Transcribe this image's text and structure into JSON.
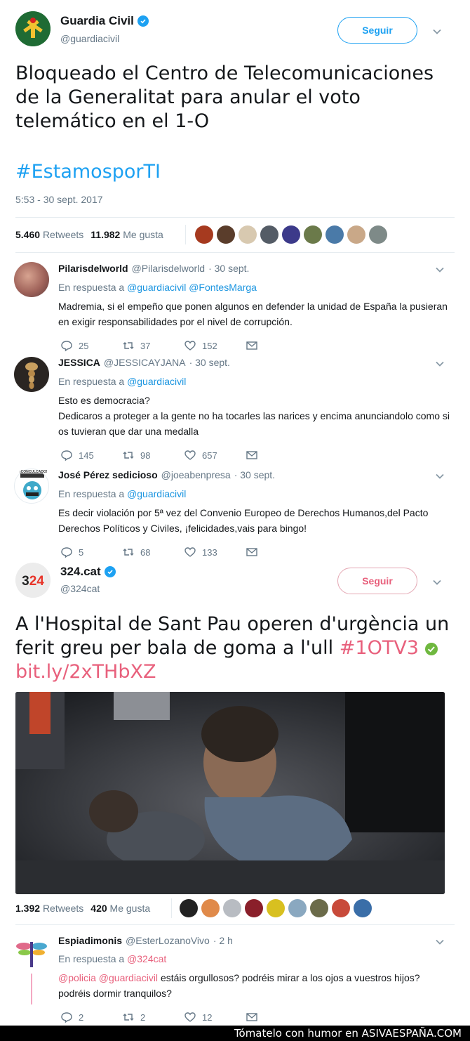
{
  "tweet1": {
    "name": "Guardia Civil",
    "handle": "@guardiacivil",
    "follow_label": "Seguir",
    "text": "Bloqueado el Centro de Telecomunicaciones de la Generalitat para anular el voto telemático en el 1-O",
    "hashtag": "#EstamosporTI",
    "timestamp": "5:53 - 30 sept. 2017",
    "retweets_count": "5.460",
    "retweets_label": "Retweets",
    "likes_count": "11.982",
    "likes_label": "Me gusta",
    "liker_colors": [
      "#a63a1f",
      "#5a3d2b",
      "#d8c9b0",
      "#545c66",
      "#3c3a8a",
      "#6b7a4a",
      "#4a7aa8",
      "#c9a888",
      "#7e8a88"
    ]
  },
  "replies": [
    {
      "name": "Pilarisdelworld",
      "handle": "@Pilarisdelworld",
      "date": "· 30 sept.",
      "in_reply_prefix": "En respuesta a",
      "mentions": [
        "@guardiacivil",
        "@FontesMarga"
      ],
      "text": "Madremia, si el empeño que ponen algunos en defender la unidad de España la pusieran en exigir responsabilidades por el nivel de corrupción.",
      "replies": "25",
      "retweets": "37",
      "likes": "152"
    },
    {
      "name": "JESSICA",
      "handle": "@JESSICAYJANA",
      "date": "· 30 sept.",
      "in_reply_prefix": "En respuesta a",
      "mentions": [
        "@guardiacivil"
      ],
      "text_line1": "Esto es democracia?",
      "text_line2": "Dedicaros a proteger a la gente no ha tocarles las narices y encima anunciandolo como si os tuvieran que dar una medalla",
      "replies": "145",
      "retweets": "98",
      "likes": "657"
    },
    {
      "name": "José Pérez sedicioso",
      "handle": "@joeabenpresa",
      "date": "· 30 sept.",
      "in_reply_prefix": "En respuesta a",
      "mentions": [
        "@guardiacivil"
      ],
      "text": "Es decir violación por 5ª vez del Convenio Europeo de Derechos Humanos,del Pacto Derechos Políticos y Civiles, ¡felicidades,vais para bingo!",
      "avatar_text": "¡CONCULCADO!",
      "replies": "5",
      "retweets": "68",
      "likes": "133"
    }
  ],
  "tweet2": {
    "name": "324.cat",
    "handle": "@324cat",
    "logo_text": "3 24",
    "follow_label": "Seguir",
    "text": "A l'Hospital de Sant Pau operen d'urgència un ferit greu per bala de goma a l'ull",
    "hashtag": "#1OTV3",
    "link": "bit.ly/2xTHbXZ",
    "retweets_count": "1.392",
    "retweets_label": "Retweets",
    "likes_count": "420",
    "likes_label": "Me gusta",
    "liker_colors": [
      "#222222",
      "#e08a4a",
      "#b8bcc2",
      "#8a1f2a",
      "#d8c020",
      "#8aa8c0",
      "#6b6b4a",
      "#c84a3a",
      "#3a6ea8"
    ]
  },
  "reply4": {
    "name": "Espiadimonis",
    "handle": "@EsterLozanoVivo",
    "date": "· 2 h",
    "in_reply_prefix": "En respuesta a",
    "mentions": [
      "@324cat"
    ],
    "mention_policia": "@policia",
    "mention_gc": "@guardiacivil",
    "text_rest": "estáis orgullosos? podréis mirar a los ojos a vuestros hijos? podréis dormir tranquilos?",
    "replies": "2",
    "retweets": "2",
    "likes": "12"
  },
  "footer": {
    "text": "Tómatelo con humor en ASIVAESPAÑA.COM"
  }
}
